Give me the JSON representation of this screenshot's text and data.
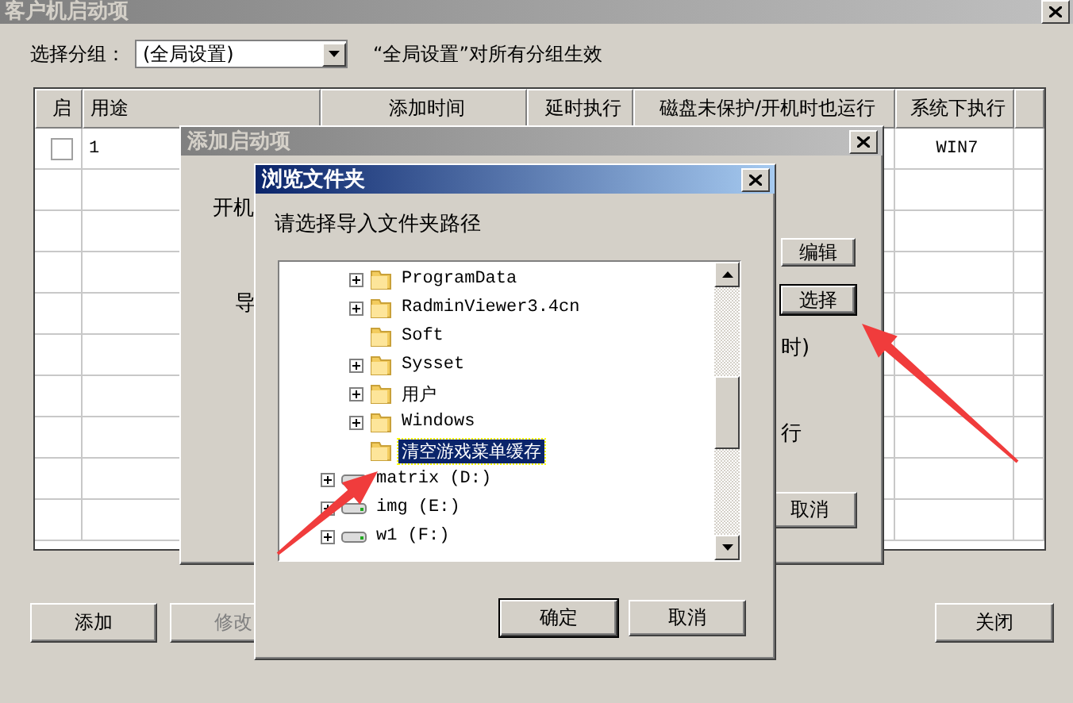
{
  "main_window": {
    "title": "客户机启动项",
    "active": false,
    "group_label": "选择分组：",
    "group_select": "(全局设置)",
    "group_note": "“全局设置”对所有分组生效",
    "table": {
      "columns": [
        "启",
        "用途",
        "添加时间",
        "延时执行",
        "磁盘未保护/开机时也运行",
        "系统下执行"
      ],
      "rows": [
        {
          "checked": false,
          "purpose": "1",
          "system": "WIN7"
        }
      ]
    },
    "buttons": [
      {
        "label": "添加",
        "disabled": false
      },
      {
        "label": "修改",
        "disabled": true
      },
      {
        "label": "关闭",
        "disabled": false
      }
    ]
  },
  "add_dialog": {
    "title": "添加启动项",
    "active": false,
    "labels": [
      "开机",
      "导",
      "时)",
      "行"
    ],
    "buttons": [
      {
        "label": "编辑",
        "focused": false
      },
      {
        "label": "选择",
        "focused": true
      },
      {
        "label": "取消",
        "focused": false
      }
    ]
  },
  "browse_dialog": {
    "title": "浏览文件夹",
    "active": true,
    "prompt": "请选择导入文件夹路径",
    "folders": [
      {
        "label": "ProgramData",
        "expandable": true,
        "selected": false
      },
      {
        "label": "RadminViewer3.4cn",
        "expandable": true,
        "selected": false
      },
      {
        "label": "Soft",
        "expandable": false,
        "selected": false
      },
      {
        "label": "Sysset",
        "expandable": true,
        "selected": false
      },
      {
        "label": "用户",
        "expandable": true,
        "selected": false
      },
      {
        "label": "Windows",
        "expandable": true,
        "selected": false
      },
      {
        "label": "清空游戏菜单缓存",
        "expandable": false,
        "selected": true
      }
    ],
    "drives": [
      {
        "label": "matrix (D:)",
        "expandable": true,
        "selected": false
      },
      {
        "label": "img (E:)",
        "expandable": true,
        "selected": false
      },
      {
        "label": "w1 (F:)",
        "expandable": true,
        "selected": false
      }
    ],
    "buttons": [
      {
        "label": "确定",
        "default": true
      },
      {
        "label": "取消",
        "default": false
      }
    ]
  }
}
